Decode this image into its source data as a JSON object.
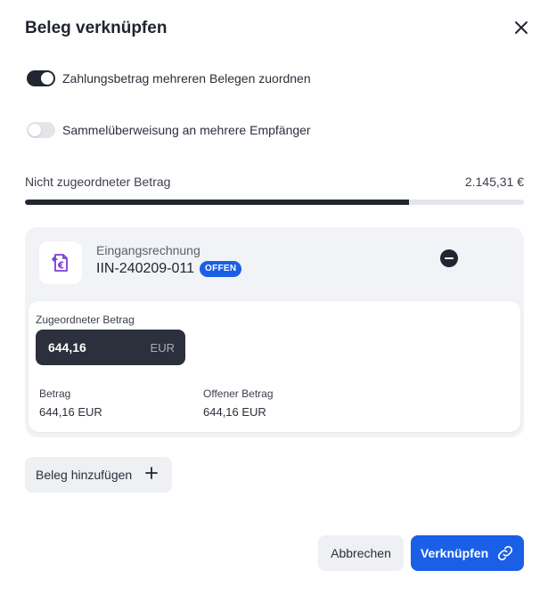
{
  "dialog": {
    "title": "Beleg verknüpfen"
  },
  "toggles": [
    {
      "label": "Zahlungsbetrag mehreren Belegen zuordnen",
      "on": true
    },
    {
      "label": "Sammelüberweisung an mehrere Empfänger",
      "on": false
    }
  ],
  "unassigned": {
    "label": "Nicht zugeordneter Betrag",
    "amount": "2.145,31 €",
    "progress_fraction": 0.77
  },
  "document": {
    "type": "Eingangsrechnung",
    "number": "IIN-240209-011",
    "status": "OFFEN",
    "icon": "euro-receipt-icon",
    "assigned_label": "Zugeordneter Betrag",
    "assigned_value": "644,16",
    "assigned_currency": "EUR",
    "amount_label": "Betrag",
    "amount_value": "644,16 EUR",
    "open_label": "Offener Betrag",
    "open_value": "644,16 EUR"
  },
  "actions": {
    "add_document": "Beleg hinzufügen",
    "cancel": "Abbrechen",
    "link": "Verknüpfen"
  },
  "colors": {
    "primary": "#1a5fe6",
    "dark": "#222631",
    "icon_accent": "#7b3fd6"
  }
}
